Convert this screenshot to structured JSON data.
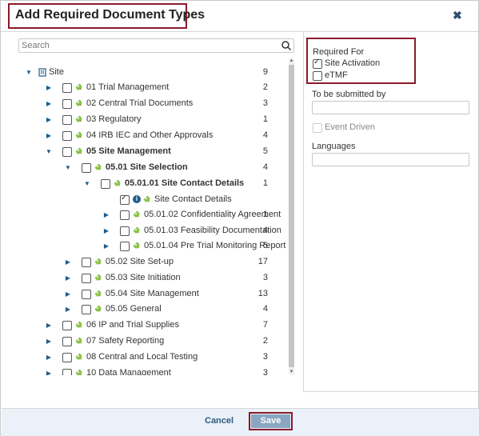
{
  "dialog": {
    "title": "Add Required Document Types",
    "close_icon": "close-icon"
  },
  "search": {
    "placeholder": "Search"
  },
  "tree": [
    {
      "arrow": "down",
      "checkbox": false,
      "icon": "site-icon",
      "label": "Site",
      "count": "9",
      "bold": false
    },
    {
      "arrow": "right",
      "checkbox": true,
      "checked": false,
      "icon": "tag-icon",
      "label": "01 Trial Management",
      "count": "2",
      "bold": false
    },
    {
      "arrow": "right",
      "checkbox": true,
      "checked": false,
      "icon": "tag-icon",
      "label": "02 Central Trial Documents",
      "count": "3",
      "bold": false
    },
    {
      "arrow": "right",
      "checkbox": true,
      "checked": false,
      "icon": "tag-icon",
      "label": "03 Regulatory",
      "count": "1",
      "bold": false
    },
    {
      "arrow": "right",
      "checkbox": true,
      "checked": false,
      "icon": "tag-icon",
      "label": "04 IRB IEC and Other Approvals",
      "count": "4",
      "bold": false
    },
    {
      "arrow": "down",
      "checkbox": true,
      "checked": false,
      "icon": "tag-icon",
      "label": "05 Site Management",
      "count": "5",
      "bold": true
    },
    {
      "arrow": "down",
      "checkbox": true,
      "checked": false,
      "icon": "tag-icon",
      "label": "05.01 Site Selection",
      "count": "4",
      "bold": true
    },
    {
      "arrow": "down",
      "checkbox": true,
      "checked": false,
      "icon": "tag-icon",
      "label": "05.01.01 Site Contact Details",
      "count": "1",
      "bold": true
    },
    {
      "arrow": "none",
      "checkbox": true,
      "checked": true,
      "info": true,
      "icon": "tag-icon",
      "label": "Site Contact Details",
      "count": "",
      "bold": false
    },
    {
      "arrow": "right",
      "checkbox": true,
      "checked": false,
      "icon": "tag-icon",
      "label": "05.01.02 Confidentiality Agreement",
      "count": "1",
      "bold": false
    },
    {
      "arrow": "right",
      "checkbox": true,
      "checked": false,
      "icon": "tag-icon",
      "label": "05.01.03 Feasibility Documentation",
      "count": "4",
      "bold": false
    },
    {
      "arrow": "right",
      "checkbox": true,
      "checked": false,
      "icon": "tag-icon",
      "label": "05.01.04 Pre Trial Monitoring Report",
      "count": "5",
      "bold": false
    },
    {
      "arrow": "right",
      "checkbox": true,
      "checked": false,
      "icon": "tag-icon",
      "label": "05.02 Site Set-up",
      "count": "17",
      "bold": false
    },
    {
      "arrow": "right",
      "checkbox": true,
      "checked": false,
      "icon": "tag-icon",
      "label": "05.03 Site Initiation",
      "count": "3",
      "bold": false
    },
    {
      "arrow": "right",
      "checkbox": true,
      "checked": false,
      "icon": "tag-icon",
      "label": "05.04 Site Management",
      "count": "13",
      "bold": false
    },
    {
      "arrow": "right",
      "checkbox": true,
      "checked": false,
      "icon": "tag-icon",
      "label": "05.05 General",
      "count": "4",
      "bold": false
    },
    {
      "arrow": "right",
      "checkbox": true,
      "checked": false,
      "icon": "tag-icon",
      "label": "06 IP and Trial Supplies",
      "count": "7",
      "bold": false
    },
    {
      "arrow": "right",
      "checkbox": true,
      "checked": false,
      "icon": "tag-icon",
      "label": "07 Safety Reporting",
      "count": "2",
      "bold": false
    },
    {
      "arrow": "right",
      "checkbox": true,
      "checked": false,
      "icon": "tag-icon",
      "label": "08 Central and Local Testing",
      "count": "3",
      "bold": false
    },
    {
      "arrow": "right",
      "checkbox": true,
      "checked": false,
      "icon": "tag-icon",
      "label": "10 Data Management",
      "count": "3",
      "bold": false
    }
  ],
  "right_panel": {
    "required_for_label": "Required For",
    "site_activation_label": "Site Activation",
    "site_activation_checked": true,
    "etmf_label": "eTMF",
    "etmf_checked": false,
    "to_be_submitted_label": "To be submitted by",
    "to_be_submitted_value": "",
    "event_driven_label": "Event Driven",
    "languages_label": "Languages",
    "languages_value": ""
  },
  "footer": {
    "cancel_label": "Cancel",
    "save_label": "Save"
  },
  "colors": {
    "accent_outline": "#8b1a2b",
    "link": "#2f5a80",
    "save_button": "#8aa6c2",
    "tag_icon": "#8bc34a",
    "tree_arrow": "#1f5d8a"
  }
}
